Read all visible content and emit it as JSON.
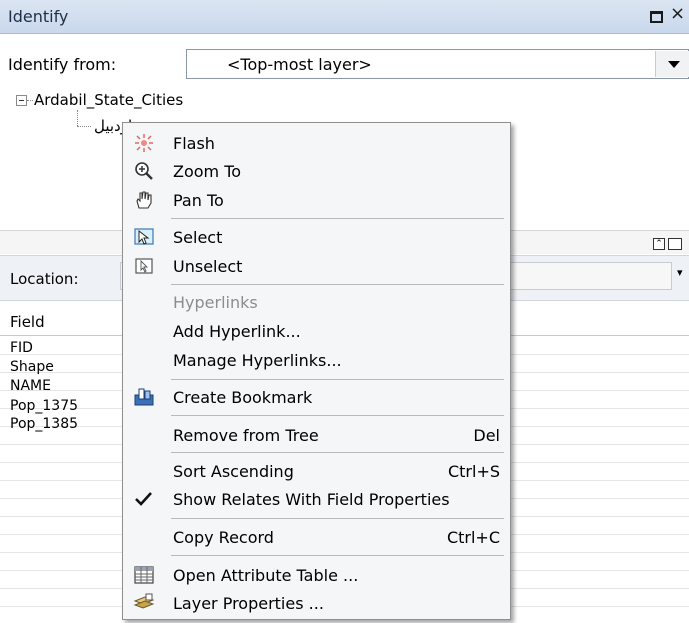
{
  "window": {
    "title": "Identify",
    "restore_label": "",
    "close_label": "×"
  },
  "identify_from": {
    "label": "Identify from:",
    "value": "<Top-most layer>"
  },
  "tree": {
    "root": "Ardabil_State_Cities",
    "child": "اردبیل"
  },
  "location": {
    "label": "Location:"
  },
  "grid": {
    "header": "Field",
    "rows": [
      "FID",
      "Shape",
      "NAME",
      "Pop_1375",
      "Pop_1385"
    ]
  },
  "menu": {
    "flash": "Flash",
    "zoom_to": "Zoom To",
    "pan_to": "Pan To",
    "select": "Select",
    "unselect": "Unselect",
    "hyperlinks": "Hyperlinks",
    "add_hyperlink": "Add Hyperlink...",
    "manage_hyperlinks": "Manage Hyperlinks...",
    "create_bookmark": "Create Bookmark",
    "remove_from_tree": "Remove from Tree",
    "remove_shortcut": "Del",
    "sort_ascending": "Sort Ascending",
    "sort_shortcut": "Ctrl+S",
    "show_relates": "Show Relates With Field Properties",
    "copy_record": "Copy Record",
    "copy_shortcut": "Ctrl+C",
    "open_attribute_table": "Open Attribute Table ...",
    "layer_properties": "Layer Properties ..."
  },
  "colors": {
    "titlebar": "#c9d8ec",
    "menu_bg": "#f5f6f7",
    "disabled_text": "#8d8d8d"
  }
}
